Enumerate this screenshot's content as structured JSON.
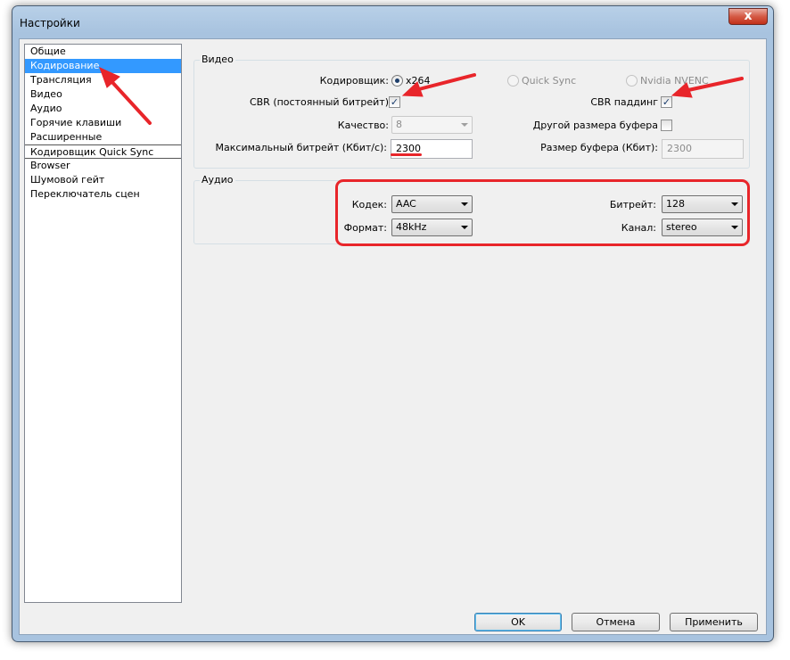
{
  "window": {
    "title": "Настройки",
    "close_label": "x"
  },
  "sidebar": {
    "items": [
      {
        "label": "Общие"
      },
      {
        "label": "Кодирование"
      },
      {
        "label": "Трансляция"
      },
      {
        "label": "Видео"
      },
      {
        "label": "Аудио"
      },
      {
        "label": "Горячие клавиши"
      },
      {
        "label": "Расширенные"
      },
      {
        "label": "Кодировщик Quick Sync"
      },
      {
        "label": "Browser"
      },
      {
        "label": "Шумовой гейт"
      },
      {
        "label": "Переключатель сцен"
      }
    ],
    "selected": "Кодирование"
  },
  "video": {
    "legend": "Видео",
    "encoder_label": "Кодировщик:",
    "encoder_options": [
      "x264",
      "Quick Sync",
      "Nvidia NVENC"
    ],
    "encoder_selected": "x264",
    "cbr_label": "CBR (постоянный битрейт)",
    "cbr_checked": true,
    "cbr_padding_label": "CBR паддинг",
    "cbr_padding_checked": true,
    "quality_label": "Качество:",
    "quality_value": "8",
    "custom_buffer_label": "Другой размера буфера",
    "custom_buffer_checked": false,
    "max_bitrate_label": "Максимальный битрейт (Кбит/с):",
    "max_bitrate_value": "2300",
    "buffer_size_label": "Размер буфера (Кбит):",
    "buffer_size_value": "2300"
  },
  "audio": {
    "legend": "Аудио",
    "codec_label": "Кодек:",
    "codec_value": "AAC",
    "bitrate_label": "Битрейт:",
    "bitrate_value": "128",
    "format_label": "Формат:",
    "format_value": "48kHz",
    "channel_label": "Канал:",
    "channel_value": "stereo"
  },
  "buttons": {
    "ok": "OK",
    "cancel": "Отмена",
    "apply": "Применить"
  },
  "colors": {
    "annotation": "#e8252a",
    "selection": "#3399ff"
  }
}
